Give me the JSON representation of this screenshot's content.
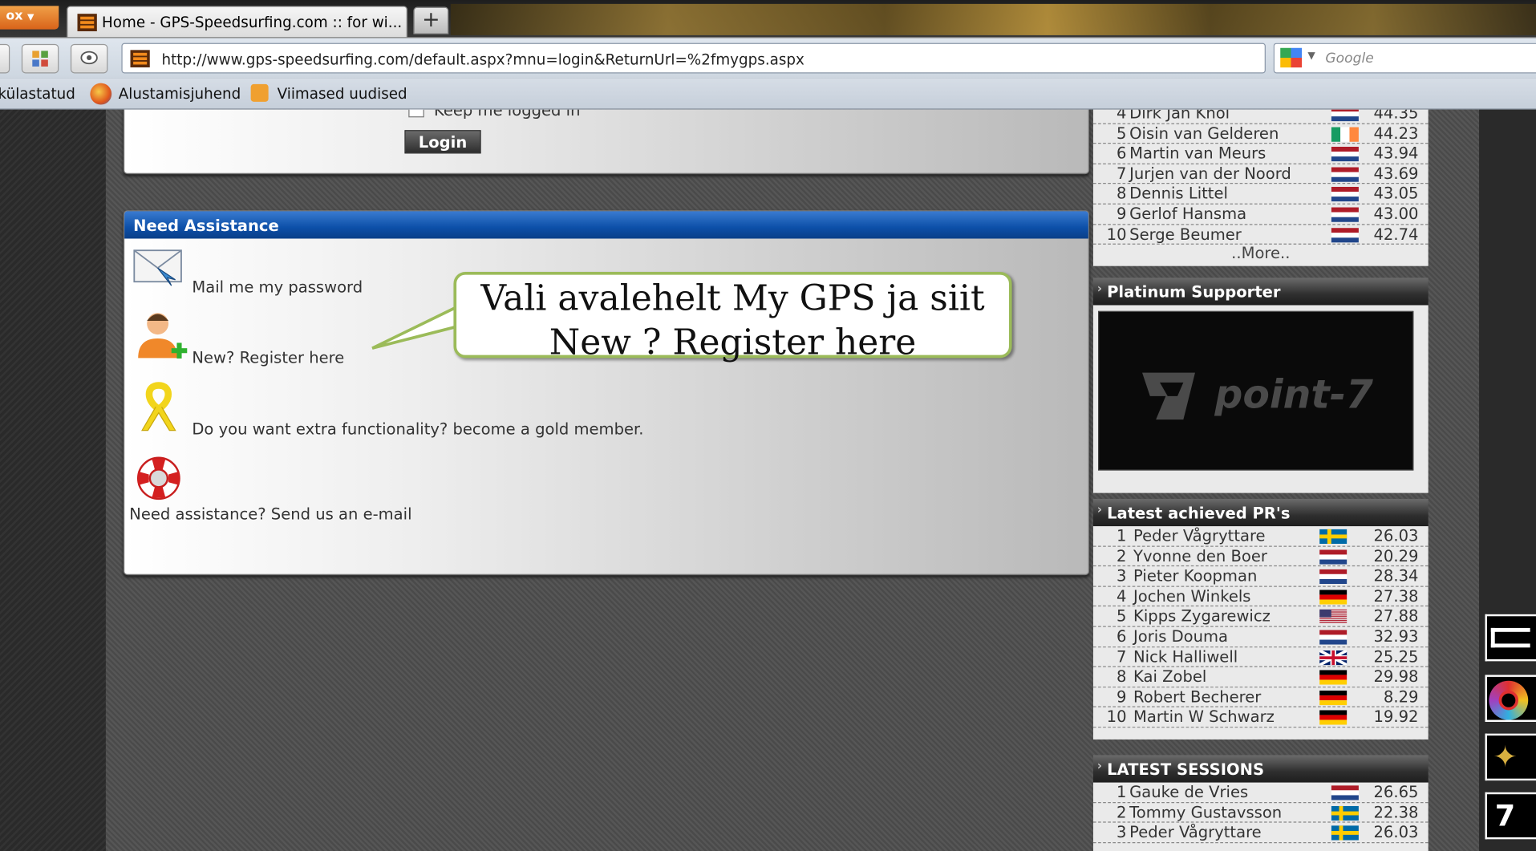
{
  "browser": {
    "menu_button": "ox",
    "tab_title": "Home - GPS-Speedsurfing.com :: for wi...",
    "new_tab": "+",
    "url": "http://www.gps-speedsurfing.com/default.aspx?mnu=login&ReturnUrl=%2fmygps.aspx",
    "search_placeholder": "Google",
    "bookmarks": [
      "külastatud",
      "Alustamisjuhend",
      "Viimased uudised"
    ]
  },
  "login": {
    "keep_logged_in": "Keep me logged in",
    "login_button": "Login"
  },
  "assistance": {
    "title": "Need Assistance",
    "mail_password": "Mail me my password",
    "register": "New? Register here",
    "gold_member": "Do you want extra functionality? become a gold member.",
    "email_help": "Need assistance? Send us an e-mail"
  },
  "callout": {
    "line1": "Vali avalehelt My GPS ja siit",
    "line2": "New ? Register here"
  },
  "top_list": {
    "more": "..More..",
    "rows": [
      {
        "rank": "4",
        "name": "Dirk Jan Knol",
        "flag": "nl",
        "value": "44.35"
      },
      {
        "rank": "5",
        "name": "Oisin van Gelderen",
        "flag": "ie",
        "value": "44.23"
      },
      {
        "rank": "6",
        "name": "Martin van Meurs",
        "flag": "nl",
        "value": "43.94"
      },
      {
        "rank": "7",
        "name": "Jurjen van der Noord",
        "flag": "nl",
        "value": "43.69"
      },
      {
        "rank": "8",
        "name": "Dennis Littel",
        "flag": "nl",
        "value": "43.05"
      },
      {
        "rank": "9",
        "name": "Gerlof Hansma",
        "flag": "nl",
        "value": "43.00"
      },
      {
        "rank": "10",
        "name": "Serge Beumer",
        "flag": "nl",
        "value": "42.74"
      }
    ]
  },
  "platinum": {
    "title": "Platinum Supporter",
    "brand": "point-7"
  },
  "latest_prs": {
    "title": "Latest achieved PR's",
    "rows": [
      {
        "rank": "1",
        "name": "Peder Vågryttare",
        "flag": "se",
        "value": "26.03"
      },
      {
        "rank": "2",
        "name": "Yvonne den Boer",
        "flag": "nl",
        "value": "20.29"
      },
      {
        "rank": "3",
        "name": "Pieter Koopman",
        "flag": "nl",
        "value": "28.34"
      },
      {
        "rank": "4",
        "name": "Jochen Winkels",
        "flag": "de",
        "value": "27.38"
      },
      {
        "rank": "5",
        "name": "Kipps Zygarewicz",
        "flag": "us",
        "value": "27.88"
      },
      {
        "rank": "6",
        "name": "Joris Douma",
        "flag": "nl",
        "value": "32.93"
      },
      {
        "rank": "7",
        "name": "Nick Halliwell",
        "flag": "gb",
        "value": "25.25"
      },
      {
        "rank": "8",
        "name": "Kai Zobel",
        "flag": "de",
        "value": "29.98"
      },
      {
        "rank": "9",
        "name": "Robert Becherer",
        "flag": "de",
        "value": "8.29"
      },
      {
        "rank": "10",
        "name": "Martin W Schwarz",
        "flag": "de",
        "value": "19.92"
      }
    ]
  },
  "latest_sessions": {
    "title": "LATEST SESSIONS",
    "rows": [
      {
        "rank": "1",
        "name": "Gauke de Vries",
        "flag": "nl",
        "value": "26.65"
      },
      {
        "rank": "2",
        "name": "Tommy Gustavsson",
        "flag": "se",
        "value": "22.38"
      },
      {
        "rank": "3",
        "name": "Peder Vågryttare",
        "flag": "se",
        "value": "26.03"
      }
    ]
  },
  "flag_colors": {
    "nl": [
      "#ae1c28",
      "#ffffff",
      "#21468b"
    ],
    "ie": [
      "#169b62",
      "#ffffff",
      "#ff883e"
    ],
    "de": [
      "#000000",
      "#dd0000",
      "#ffce00"
    ],
    "se": [
      "#006aa7",
      "#fecc00"
    ],
    "us": [
      "#b22234",
      "#ffffff",
      "#3c3b6e"
    ],
    "gb": [
      "#012169",
      "#ffffff",
      "#c8102e"
    ]
  }
}
